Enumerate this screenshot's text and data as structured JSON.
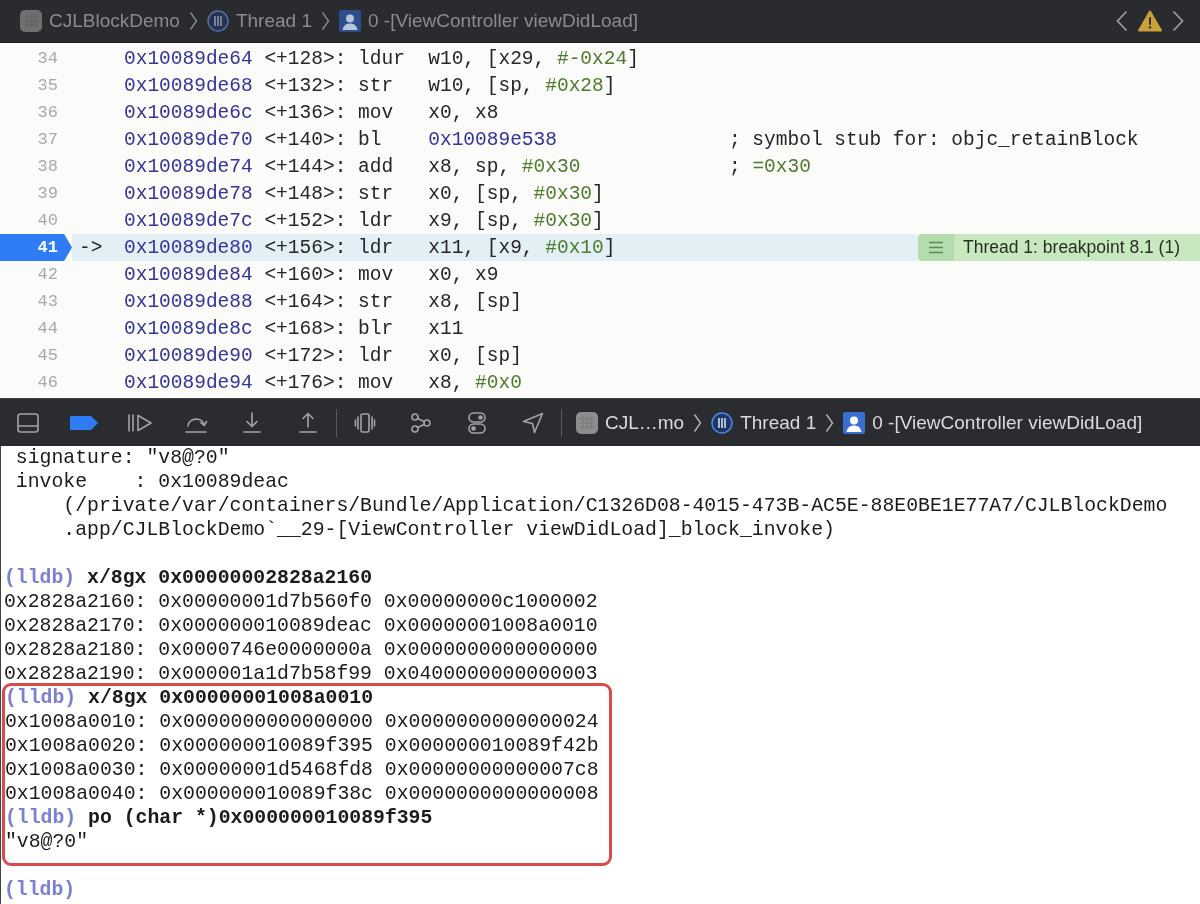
{
  "jump_bar": {
    "items": [
      {
        "kind": "app",
        "label": "CJLBlockDemo"
      },
      {
        "kind": "thread",
        "label": "Thread 1"
      },
      {
        "kind": "frame",
        "label": "0 -[ViewController viewDidLoad]"
      }
    ]
  },
  "disassembly": {
    "rows": [
      {
        "line": "34",
        "address": "0x10089de64",
        "offset": "<+128>:",
        "mnemonic": "ldur",
        "operands": [
          {
            "kind": "text",
            "text": "w10, [x29, "
          },
          {
            "kind": "number",
            "text": "#-0x24"
          },
          {
            "kind": "text",
            "text": "]"
          }
        ],
        "breakpoint": false,
        "current": false
      },
      {
        "line": "35",
        "address": "0x10089de68",
        "offset": "<+132>:",
        "mnemonic": "str",
        "operands": [
          {
            "kind": "text",
            "text": "w10, [sp, "
          },
          {
            "kind": "number",
            "text": "#0x28"
          },
          {
            "kind": "text",
            "text": "]"
          }
        ],
        "breakpoint": false,
        "current": false
      },
      {
        "line": "36",
        "address": "0x10089de6c",
        "offset": "<+136>:",
        "mnemonic": "mov",
        "operands": [
          {
            "kind": "text",
            "text": "x0, x8"
          }
        ],
        "breakpoint": false,
        "current": false
      },
      {
        "line": "37",
        "address": "0x10089de70",
        "offset": "<+140>:",
        "mnemonic": "bl",
        "operands": [
          {
            "kind": "address",
            "text": "0x10089e538"
          }
        ],
        "comment": [
          {
            "kind": "text",
            "text": "; symbol stub for: objc_retainBlock"
          }
        ],
        "breakpoint": false,
        "current": false
      },
      {
        "line": "38",
        "address": "0x10089de74",
        "offset": "<+144>:",
        "mnemonic": "add",
        "operands": [
          {
            "kind": "text",
            "text": "x8, sp, "
          },
          {
            "kind": "number",
            "text": "#0x30"
          }
        ],
        "comment": [
          {
            "kind": "text",
            "text": "; "
          },
          {
            "kind": "number",
            "text": "=0x30"
          }
        ],
        "breakpoint": false,
        "current": false
      },
      {
        "line": "39",
        "address": "0x10089de78",
        "offset": "<+148>:",
        "mnemonic": "str",
        "operands": [
          {
            "kind": "text",
            "text": "x0, [sp, "
          },
          {
            "kind": "number",
            "text": "#0x30"
          },
          {
            "kind": "text",
            "text": "]"
          }
        ],
        "breakpoint": false,
        "current": false
      },
      {
        "line": "40",
        "address": "0x10089de7c",
        "offset": "<+152>:",
        "mnemonic": "ldr",
        "operands": [
          {
            "kind": "text",
            "text": "x9, [sp, "
          },
          {
            "kind": "number",
            "text": "#0x30"
          },
          {
            "kind": "text",
            "text": "]"
          }
        ],
        "breakpoint": false,
        "current": false
      },
      {
        "line": "41",
        "pc_marker": "->",
        "address": "0x10089de80",
        "offset": "<+156>:",
        "mnemonic": "ldr",
        "operands": [
          {
            "kind": "text",
            "text": "x11, [x9, "
          },
          {
            "kind": "number",
            "text": "#0x10"
          },
          {
            "kind": "text",
            "text": "]"
          }
        ],
        "breakpoint": true,
        "current": true,
        "annotation": "Thread 1: breakpoint 8.1 (1)"
      },
      {
        "line": "42",
        "address": "0x10089de84",
        "offset": "<+160>:",
        "mnemonic": "mov",
        "operands": [
          {
            "kind": "text",
            "text": "x0, x9"
          }
        ],
        "breakpoint": false,
        "current": false
      },
      {
        "line": "43",
        "address": "0x10089de88",
        "offset": "<+164>:",
        "mnemonic": "str",
        "operands": [
          {
            "kind": "text",
            "text": "x8, [sp]"
          }
        ],
        "breakpoint": false,
        "current": false
      },
      {
        "line": "44",
        "address": "0x10089de8c",
        "offset": "<+168>:",
        "mnemonic": "blr",
        "operands": [
          {
            "kind": "text",
            "text": "x11"
          }
        ],
        "breakpoint": false,
        "current": false
      },
      {
        "line": "45",
        "address": "0x10089de90",
        "offset": "<+172>:",
        "mnemonic": "ldr",
        "operands": [
          {
            "kind": "text",
            "text": "x0, [sp]"
          }
        ],
        "breakpoint": false,
        "current": false
      },
      {
        "line": "46",
        "address": "0x10089de94",
        "offset": "<+176>:",
        "mnemonic": "mov",
        "operands": [
          {
            "kind": "text",
            "text": "x8, "
          },
          {
            "kind": "number",
            "text": "#0x0"
          }
        ],
        "breakpoint": false,
        "current": false
      }
    ]
  },
  "debug_bar": {
    "buttons": [
      {
        "kind": "panel",
        "on": false
      },
      {
        "kind": "breakpoints",
        "on": true
      },
      {
        "kind": "continue",
        "on": false
      },
      {
        "kind": "step-over",
        "on": false
      },
      {
        "kind": "step-into",
        "on": false
      },
      {
        "kind": "step-out",
        "on": false
      }
    ],
    "tools": [
      {
        "kind": "view-hierarchy",
        "on": false
      },
      {
        "kind": "memory-graph",
        "on": false
      },
      {
        "kind": "environment",
        "on": false
      },
      {
        "kind": "location",
        "on": false
      }
    ],
    "breadcrumb": [
      {
        "kind": "app",
        "label": "CJL…mo"
      },
      {
        "kind": "thread",
        "label": "Thread 1"
      },
      {
        "kind": "frame",
        "label": "0 -[ViewController viewDidLoad]"
      }
    ]
  },
  "console": {
    "blocks": [
      {
        "highlighted": false,
        "lines": [
          {
            "kind": "output",
            "text": " signature: \"v8@?0\""
          },
          {
            "kind": "output",
            "text": " invoke    : 0x10089deac"
          },
          {
            "kind": "output",
            "text": "     (/private/var/containers/Bundle/Application/C1326D08-4015-473B-AC5E-88E0BE1E77A7/CJLBlockDemo"
          },
          {
            "kind": "output",
            "text": "     .app/CJLBlockDemo`__29-[ViewController viewDidLoad]_block_invoke)"
          },
          {
            "kind": "blank"
          },
          {
            "kind": "command",
            "prompt": "(lldb)",
            "text": "x/8gx 0x00000002828a2160"
          },
          {
            "kind": "output",
            "text": "0x2828a2160: 0x00000001d7b560f0 0x00000000c1000002"
          },
          {
            "kind": "output",
            "text": "0x2828a2170: 0x000000010089deac 0x00000001008a0010"
          },
          {
            "kind": "output",
            "text": "0x2828a2180: 0x0000746e0000000a 0x0000000000000000"
          },
          {
            "kind": "output",
            "text": "0x2828a2190: 0x000001a1d7b58f99 0x0400000000000003"
          }
        ]
      },
      {
        "highlighted": true,
        "lines": [
          {
            "kind": "command",
            "prompt": "(lldb)",
            "text": "x/8gx 0x00000001008a0010"
          },
          {
            "kind": "output",
            "text": "0x1008a0010: 0x0000000000000000 0x0000000000000024"
          },
          {
            "kind": "output",
            "text": "0x1008a0020: 0x000000010089f395 0x000000010089f42b"
          },
          {
            "kind": "output",
            "text": "0x1008a0030: 0x00000001d5468fd8 0x00000000000007c8"
          },
          {
            "kind": "output",
            "text": "0x1008a0040: 0x000000010089f38c 0x0000000000000008"
          },
          {
            "kind": "command",
            "prompt": "(lldb)",
            "text": "po (char *)0x000000010089f395"
          },
          {
            "kind": "output",
            "text": "\"v8@?0\""
          }
        ]
      },
      {
        "highlighted": false,
        "lines": [
          {
            "kind": "blank"
          },
          {
            "kind": "command",
            "prompt": "(lldb)"
          }
        ]
      }
    ]
  }
}
